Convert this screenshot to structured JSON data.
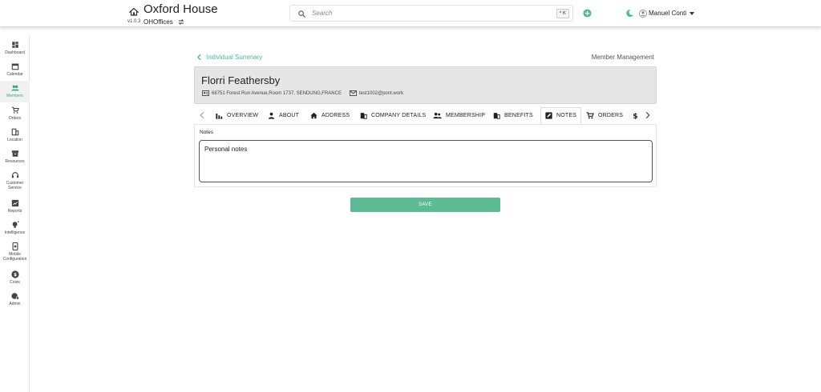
{
  "header": {
    "app_title": "Oxford House",
    "version": "v1.0.3",
    "org": "OHOffices",
    "search_placeholder": "Search",
    "shortcut": "^ K",
    "user_name": "Manuel Conti",
    "accent": "#4cba94"
  },
  "sidebar": {
    "items": [
      {
        "label": "Dashboard",
        "icon": "dashboard-icon"
      },
      {
        "label": "Calendar",
        "icon": "calendar-icon"
      },
      {
        "label": "Members",
        "icon": "members-icon",
        "active": true
      },
      {
        "label": "Orders",
        "icon": "cart-icon"
      },
      {
        "label": "Location",
        "icon": "building-icon"
      },
      {
        "label": "Resources",
        "icon": "archive-icon"
      },
      {
        "label": "Customer Service",
        "icon": "headset-icon"
      },
      {
        "label": "Reports",
        "icon": "report-icon"
      },
      {
        "label": "Intelligence",
        "icon": "bulb-icon"
      },
      {
        "label": "Mobile Configuration",
        "icon": "mobile-icon"
      },
      {
        "label": "Costs",
        "icon": "dollar-icon"
      },
      {
        "label": "Admin",
        "icon": "admin-icon"
      }
    ]
  },
  "breadcrumb": {
    "back_label": "Individual Summary",
    "section": "Member Management"
  },
  "member": {
    "name": "Florri Feathersby",
    "address": "68751 Forest Run Avenue,Room 1737, SENDUNG,FRANCE",
    "email": "test1002@pont.work"
  },
  "tabs": [
    {
      "label": "OVERVIEW",
      "icon": "chart-bar-icon"
    },
    {
      "label": "ABOUT",
      "icon": "person-icon"
    },
    {
      "label": "ADDRESS",
      "icon": "house-icon"
    },
    {
      "label": "COMPANY DETAILS",
      "icon": "company-icon"
    },
    {
      "label": "MEMBERSHIP",
      "icon": "group-icon"
    },
    {
      "label": "BENEFITS",
      "icon": "benefits-icon"
    },
    {
      "label": "NOTES",
      "icon": "edit-note-icon",
      "active": true
    },
    {
      "label": "ORDERS",
      "icon": "cart-icon"
    },
    {
      "label": "",
      "icon": "dollar-icon"
    }
  ],
  "notes": {
    "label": "Notes",
    "value": "Personal notes"
  },
  "actions": {
    "save_label": "SAVE"
  }
}
